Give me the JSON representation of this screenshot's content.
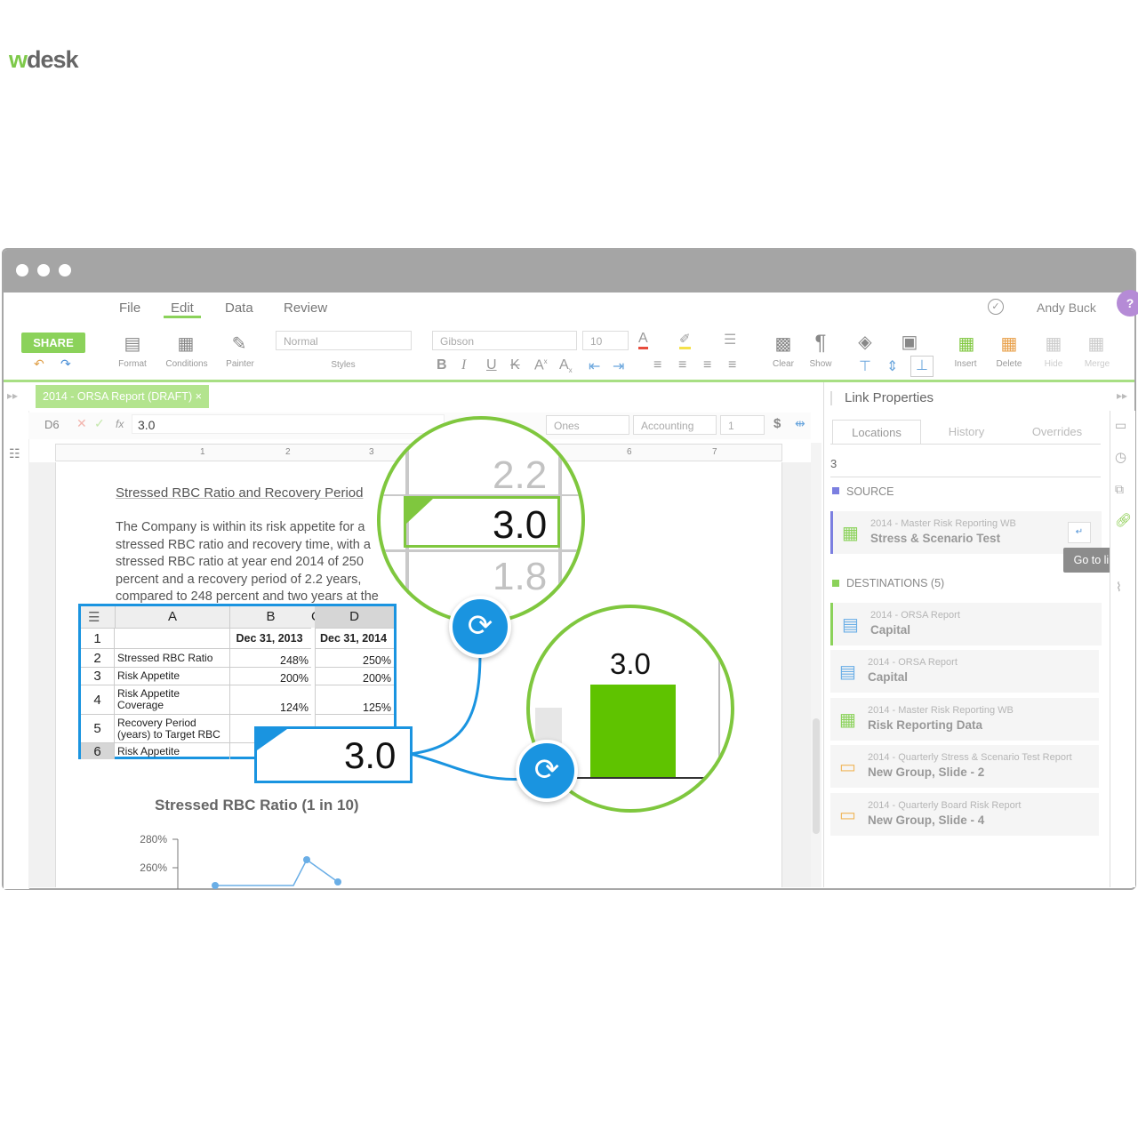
{
  "app": {
    "logo_prefix": "w",
    "logo_rest": "desk",
    "user": "Andy Buck",
    "help": "?"
  },
  "menu": {
    "file": "File",
    "edit": "Edit",
    "data": "Data",
    "review": "Review"
  },
  "ribbon": {
    "share": "SHARE",
    "format": "Format",
    "conditions": "Conditions",
    "painter": "Painter",
    "style_value": "Normal",
    "styles": "Styles",
    "font_value": "Gibson",
    "size_value": "10",
    "clear": "Clear",
    "show": "Show",
    "insert": "Insert",
    "delete": "Delete",
    "hide": "Hide",
    "merge": "Merge"
  },
  "document": {
    "tab": "2014 - ORSA Report (DRAFT)",
    "cell_ref": "D6",
    "formula_value": "3.0",
    "number_format": "Ones",
    "format_type": "Accounting",
    "decimals": "1",
    "ruler_marks": [
      "1",
      "2",
      "3",
      "6",
      "7"
    ],
    "heading": "Stressed RBC Ratio and Recovery Period",
    "paragraph_lines": [
      "The Company is within its risk appetite for a",
      "stressed RBC ratio and recovery time, with a",
      "stressed RBC ratio at year end 2014 of 250",
      "percent and a recovery period of 2.2 years,",
      "compared to 248 percent and two years at the"
    ]
  },
  "sheet": {
    "col_headers": [
      "A",
      "B",
      "C",
      "D"
    ],
    "rows": [
      {
        "n": "1",
        "a": "",
        "b": "Dec 31, 2013",
        "d": "Dec 31, 2014"
      },
      {
        "n": "2",
        "a": "Stressed RBC Ratio",
        "b": "248%",
        "d": "250%"
      },
      {
        "n": "3",
        "a": "Risk Appetite",
        "b": "200%",
        "d": "200%"
      },
      {
        "n": "4",
        "a": "Risk Appetite\nCoverage",
        "b": "124%",
        "d": "125%"
      },
      {
        "n": "5",
        "a": "Recovery Period\n(years) to Target RBC",
        "b": "",
        "d": ""
      },
      {
        "n": "6",
        "a": "Risk Appetite",
        "b": "",
        "d": ""
      }
    ]
  },
  "callouts": {
    "zoom_top": "2.2",
    "zoom_mid": "3.0",
    "zoom_bot": "1.8",
    "linked_value": "3.0",
    "bar_value": "3.0"
  },
  "chart_data": {
    "type": "line",
    "title": "Stressed RBC Ratio (1 in 10)",
    "y_ticks": [
      "280%",
      "260%"
    ],
    "ylim": [
      250,
      280
    ]
  },
  "panel": {
    "title": "Link Properties",
    "tabs": [
      "Locations",
      "History",
      "Overrides"
    ],
    "search_value": "3",
    "source_label": "SOURCE",
    "source": {
      "title": "2014 - Master Risk Reporting WB",
      "name": "Stress & Scenario Test"
    },
    "tooltip": "Go to link",
    "dest_label": "DESTINATIONS (5)",
    "destinations": [
      {
        "title": "2014 - ORSA Report",
        "name": "Capital"
      },
      {
        "title": "2014 - ORSA Report",
        "name": "Capital"
      },
      {
        "title": "2014 - Master Risk Reporting WB",
        "name": "Risk Reporting Data"
      },
      {
        "title": "2014 - Quarterly Stress & Scenario Test Report",
        "name": "New Group, Slide - 2"
      },
      {
        "title": "2014 - Quarterly Board Risk Report",
        "name": "New Group, Slide - 4"
      }
    ]
  },
  "colors": {
    "brand_green": "#7fc73e",
    "link_blue": "#1a94e0",
    "bar_green": "#5fc300"
  }
}
